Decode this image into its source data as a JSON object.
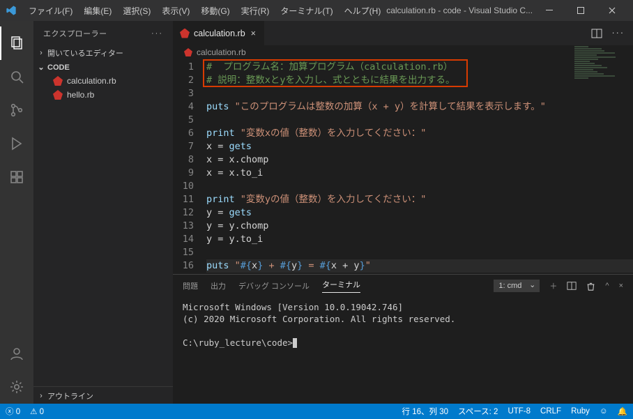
{
  "window": {
    "title": "calculation.rb - code - Visual Studio C..."
  },
  "menu": {
    "file": "ファイル(F)",
    "edit": "編集(E)",
    "select": "選択(S)",
    "view": "表示(V)",
    "go": "移動(G)",
    "run": "実行(R)",
    "terminal": "ターミナル(T)",
    "help": "ヘルプ(H)"
  },
  "sidebar": {
    "title": "エクスプローラー",
    "open_editors": "開いているエディター",
    "folder": "CODE",
    "files": [
      "calculation.rb",
      "hello.rb"
    ],
    "outline": "アウトライン"
  },
  "tab": {
    "name": "calculation.rb",
    "breadcrumb": "calculation.rb"
  },
  "code": {
    "lines": [
      {
        "n": 1,
        "seg": [
          {
            "c": "comment",
            "t": "#  プログラム名：加算プログラム（calculation.rb）"
          }
        ]
      },
      {
        "n": 2,
        "seg": [
          {
            "c": "comment",
            "t": "# 説明：整数xとyを入力し、式とともに結果を出力する。"
          }
        ]
      },
      {
        "n": 3,
        "seg": []
      },
      {
        "n": 4,
        "seg": [
          {
            "c": "ident",
            "t": "puts "
          },
          {
            "c": "string",
            "t": "\"このプログラムは整数の加算（x + y）を計算して結果を表示します。\""
          }
        ]
      },
      {
        "n": 5,
        "seg": []
      },
      {
        "n": 6,
        "seg": [
          {
            "c": "ident",
            "t": "print "
          },
          {
            "c": "string",
            "t": "\"変数xの値（整数）を入力してください：\""
          }
        ]
      },
      {
        "n": 7,
        "seg": [
          {
            "c": "op",
            "t": "x = "
          },
          {
            "c": "ident",
            "t": "gets"
          }
        ]
      },
      {
        "n": 8,
        "seg": [
          {
            "c": "op",
            "t": "x = x.chomp"
          }
        ]
      },
      {
        "n": 9,
        "seg": [
          {
            "c": "op",
            "t": "x = x.to_i"
          }
        ]
      },
      {
        "n": 10,
        "seg": []
      },
      {
        "n": 11,
        "seg": [
          {
            "c": "ident",
            "t": "print "
          },
          {
            "c": "string",
            "t": "\"変数yの値（整数）を入力してください：\""
          }
        ]
      },
      {
        "n": 12,
        "seg": [
          {
            "c": "op",
            "t": "y = "
          },
          {
            "c": "ident",
            "t": "gets"
          }
        ]
      },
      {
        "n": 13,
        "seg": [
          {
            "c": "op",
            "t": "y = y.chomp"
          }
        ]
      },
      {
        "n": 14,
        "seg": [
          {
            "c": "op",
            "t": "y = y.to_i"
          }
        ]
      },
      {
        "n": 15,
        "seg": []
      },
      {
        "n": 16,
        "seg": [
          {
            "c": "ident",
            "t": "puts "
          },
          {
            "c": "string",
            "t": "\""
          },
          {
            "c": "interp",
            "t": "#{"
          },
          {
            "c": "op",
            "t": "x"
          },
          {
            "c": "interp",
            "t": "}"
          },
          {
            "c": "string",
            "t": " + "
          },
          {
            "c": "interp",
            "t": "#{"
          },
          {
            "c": "op",
            "t": "y"
          },
          {
            "c": "interp",
            "t": "}"
          },
          {
            "c": "string",
            "t": " = "
          },
          {
            "c": "interp",
            "t": "#{"
          },
          {
            "c": "op",
            "t": "x + y"
          },
          {
            "c": "interp",
            "t": "}"
          },
          {
            "c": "string",
            "t": "\""
          }
        ]
      }
    ]
  },
  "panel": {
    "tabs": {
      "problems": "問題",
      "output": "出力",
      "debug": "デバッグ コンソール",
      "terminal": "ターミナル"
    },
    "shell_label": "1: cmd",
    "term_lines": [
      "Microsoft Windows [Version 10.0.19042.746]",
      "(c) 2020 Microsoft Corporation. All rights reserved.",
      "",
      "C:\\ruby_lecture\\code>"
    ]
  },
  "status": {
    "errors": "0",
    "warnings": "0",
    "line_col": "行 16、列 30",
    "spaces": "スペース: 2",
    "encoding": "UTF-8",
    "eol": "CRLF",
    "lang": "Ruby"
  }
}
